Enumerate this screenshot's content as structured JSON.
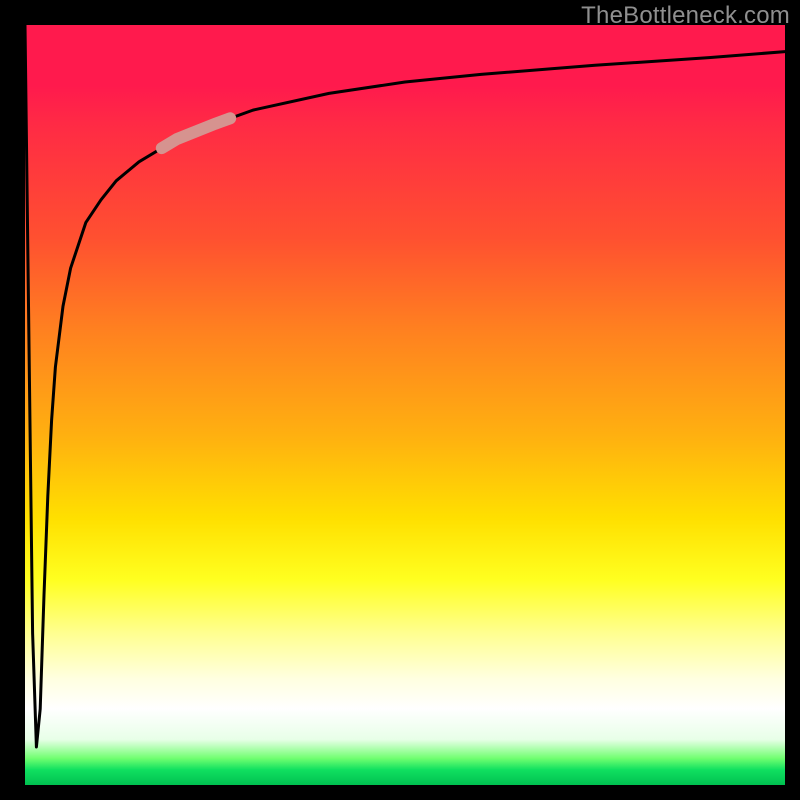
{
  "watermark": "TheBottleneck.com",
  "chart_data": {
    "type": "line",
    "title": "",
    "xlabel": "",
    "ylabel": "",
    "x_range": [
      0,
      100
    ],
    "y_range": [
      0,
      100
    ],
    "curve": {
      "x": [
        0,
        0.5,
        1,
        1.5,
        2,
        2.5,
        3,
        3.5,
        4,
        5,
        6,
        8,
        10,
        12,
        15,
        20,
        25,
        30,
        40,
        50,
        60,
        75,
        90,
        100
      ],
      "y": [
        100,
        60,
        20,
        5,
        10,
        25,
        38,
        48,
        55,
        63,
        68,
        74,
        77,
        79.5,
        82,
        85,
        87,
        88.8,
        91,
        92.5,
        93.5,
        94.7,
        95.7,
        96.5
      ]
    },
    "highlight_segment": {
      "x_start": 18,
      "x_end": 27
    },
    "colors": {
      "curve": "#000000",
      "highlight": "#d6938f",
      "gradient_top": "#ff1a4d",
      "gradient_bottom": "#00c050"
    }
  }
}
